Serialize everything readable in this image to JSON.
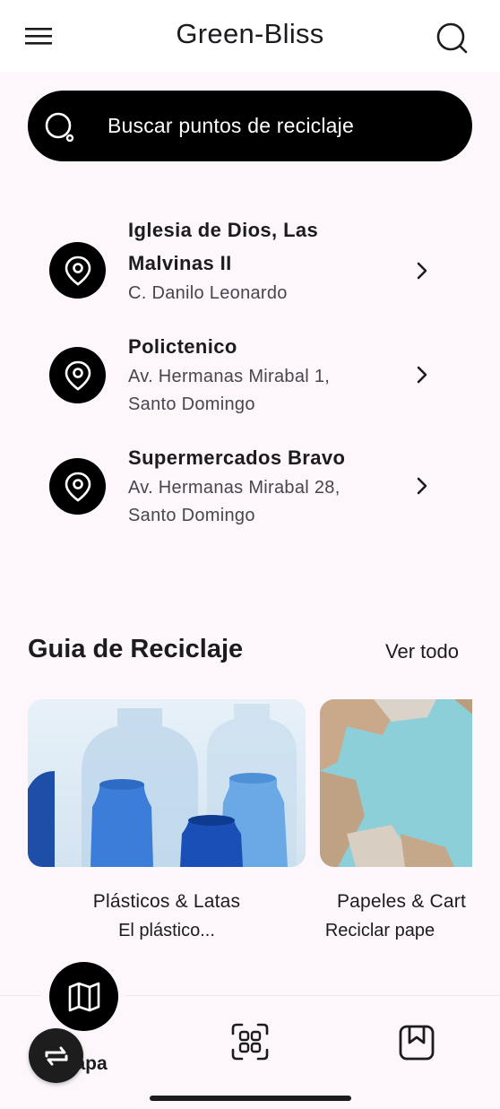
{
  "app": {
    "title": "Green-Bliss"
  },
  "icons": {
    "menu": "hamburger-menu-icon",
    "top_search": "search-icon",
    "bar_search": "search-icon",
    "place": "location-pin-icon",
    "chevron": "chevron-right-icon",
    "map": "map-icon",
    "swap": "swap-icon",
    "scan": "qr-scan-icon",
    "book": "bookmark-book-icon"
  },
  "search": {
    "placeholder": "Buscar puntos de reciclaje"
  },
  "places": [
    {
      "name_line1": "Iglesia de Dios, Las",
      "name_line2": "Malvinas II",
      "addr_line1": "C. Danilo Leonardo",
      "addr_line2": ""
    },
    {
      "name_line1": "Polictenico",
      "name_line2": "",
      "addr_line1": "Av. Hermanas Mirabal 1,",
      "addr_line2": "Santo Domingo"
    },
    {
      "name_line1": "Supermercados Bravo",
      "name_line2": "",
      "addr_line1": "Av. Hermanas Mirabal 28,",
      "addr_line2": "Santo Domingo"
    }
  ],
  "guide": {
    "title": "Guia de Reciclaje",
    "see_all": "Ver todo",
    "cards": [
      {
        "title": "Plásticos & Latas",
        "subtitle": "El plástico..."
      },
      {
        "title": "Papeles & Cart",
        "subtitle": "Reciclar pape"
      }
    ]
  },
  "bottom_nav": {
    "active_label": "Mapa"
  },
  "colors": {
    "background": "#fdf7fc",
    "accent": "#000000",
    "text": "#1c1b1f"
  }
}
